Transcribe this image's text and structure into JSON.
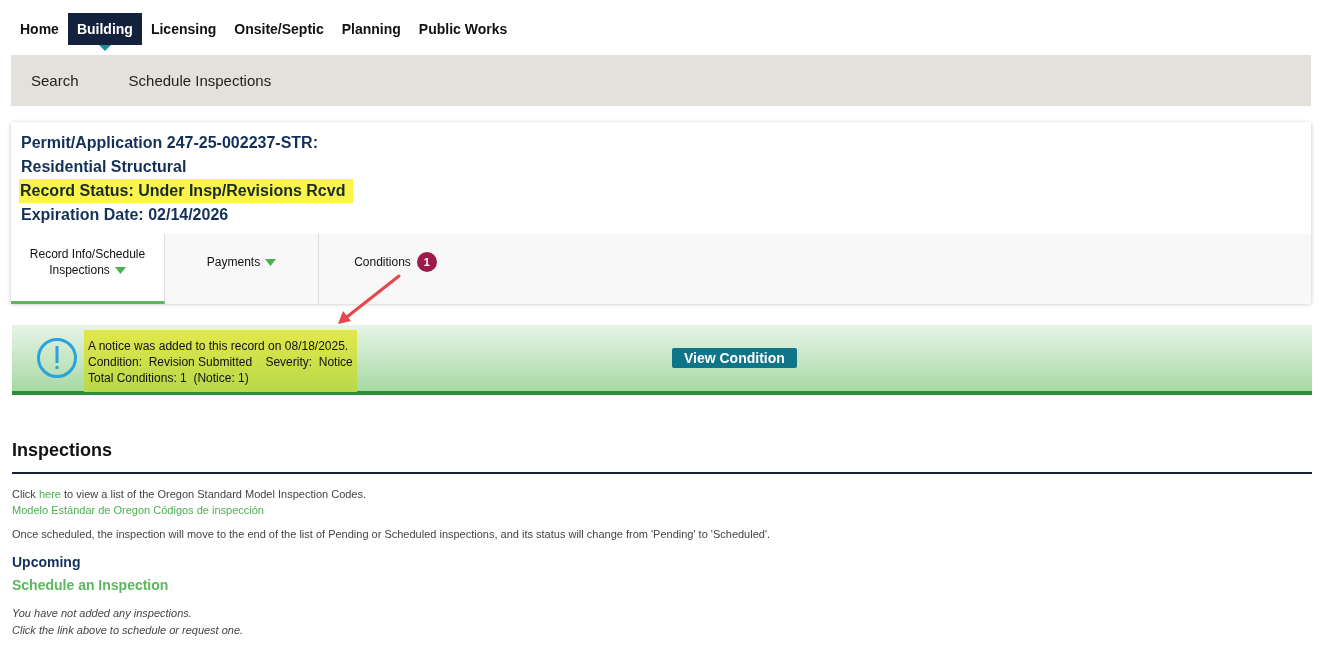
{
  "nav": [
    {
      "label": "Home",
      "selected": false
    },
    {
      "label": "Building",
      "selected": true
    },
    {
      "label": "Licensing",
      "selected": false
    },
    {
      "label": "Onsite/Septic",
      "selected": false
    },
    {
      "label": "Planning",
      "selected": false
    },
    {
      "label": "Public Works",
      "selected": false
    }
  ],
  "subnav": [
    "Search",
    "Schedule Inspections"
  ],
  "record": {
    "lines": [
      {
        "text": "Permit/Application 247-25-002237-STR:",
        "highlighted": false
      },
      {
        "text": "Residential Structural",
        "highlighted": false
      },
      {
        "text": "Record Status: Under Insp/Revisions Rcvd",
        "highlighted": true
      },
      {
        "text": "Expiration Date: 02/14/2026",
        "highlighted": false
      }
    ],
    "tabs": [
      {
        "label": "Record Info/Schedule Inspections",
        "selected": true,
        "dropdown": true
      },
      {
        "label": "Payments",
        "selected": false,
        "dropdown": true
      },
      {
        "label": "Conditions",
        "selected": false,
        "dropdown": false,
        "badge": "1"
      }
    ]
  },
  "notice": {
    "lines": [
      "A notice was added to this record on 08/18/2025.",
      "Condition:  Revision Submitted    Severity:  Notice",
      "Total Conditions: 1  (Notice: 1)"
    ],
    "button": "View Condition"
  },
  "inspections": {
    "title": "Inspections",
    "codes": {
      "before": "Click ",
      "link": "here",
      "after": " to view a list of the Oregon Standard Model Inspection Codes."
    },
    "spanish_link": "Modelo Estándar de Oregon Códigos de inspección",
    "note": "Once scheduled, the inspection will move to the end of the list of Pending or Scheduled inspections, and its status will change from 'Pending' to 'Scheduled'.",
    "upcoming": "Upcoming",
    "schedule_link": "Schedule an Inspection",
    "empty": [
      "You have not added any inspections.",
      "Click the link above to schedule or request one."
    ]
  }
}
